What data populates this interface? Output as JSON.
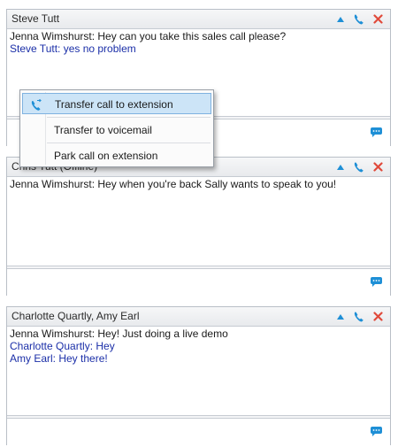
{
  "panels": [
    {
      "title": "Steve Tutt",
      "messages": [
        {
          "text": "Jenna Wimshurst: Hey can you take this sales call please?",
          "kind": "other"
        },
        {
          "text": "Steve Tutt: yes no problem",
          "kind": "self"
        }
      ]
    },
    {
      "title": "Chris Tutt (Offline)",
      "messages": [
        {
          "text": "Jenna Wimshurst: Hey when you're back Sally wants to speak to you!",
          "kind": "other"
        }
      ]
    },
    {
      "title": "Charlotte Quartly, Amy Earl",
      "messages": [
        {
          "text": "Jenna Wimshurst: Hey! Just doing a live demo",
          "kind": "other"
        },
        {
          "text": "Charlotte Quartly: Hey",
          "kind": "self"
        },
        {
          "text": "Amy Earl: Hey there!",
          "kind": "self"
        }
      ]
    }
  ],
  "context_menu": {
    "items": [
      {
        "label": "Transfer call to extension",
        "icon": "transfer-phone-icon",
        "selected": true
      },
      {
        "label": "Transfer to voicemail"
      },
      {
        "label": "Park call on extension"
      }
    ]
  },
  "colors": {
    "other_text": "#1a1a1a",
    "self_text": "#1b2fa8",
    "icon_blue": "#1e8fd6",
    "close_red": "#e04a3b"
  },
  "icons": {
    "collapse": "caret-up-icon",
    "call": "phone-icon",
    "close": "close-x-icon",
    "send": "chat-bubble-icon"
  }
}
